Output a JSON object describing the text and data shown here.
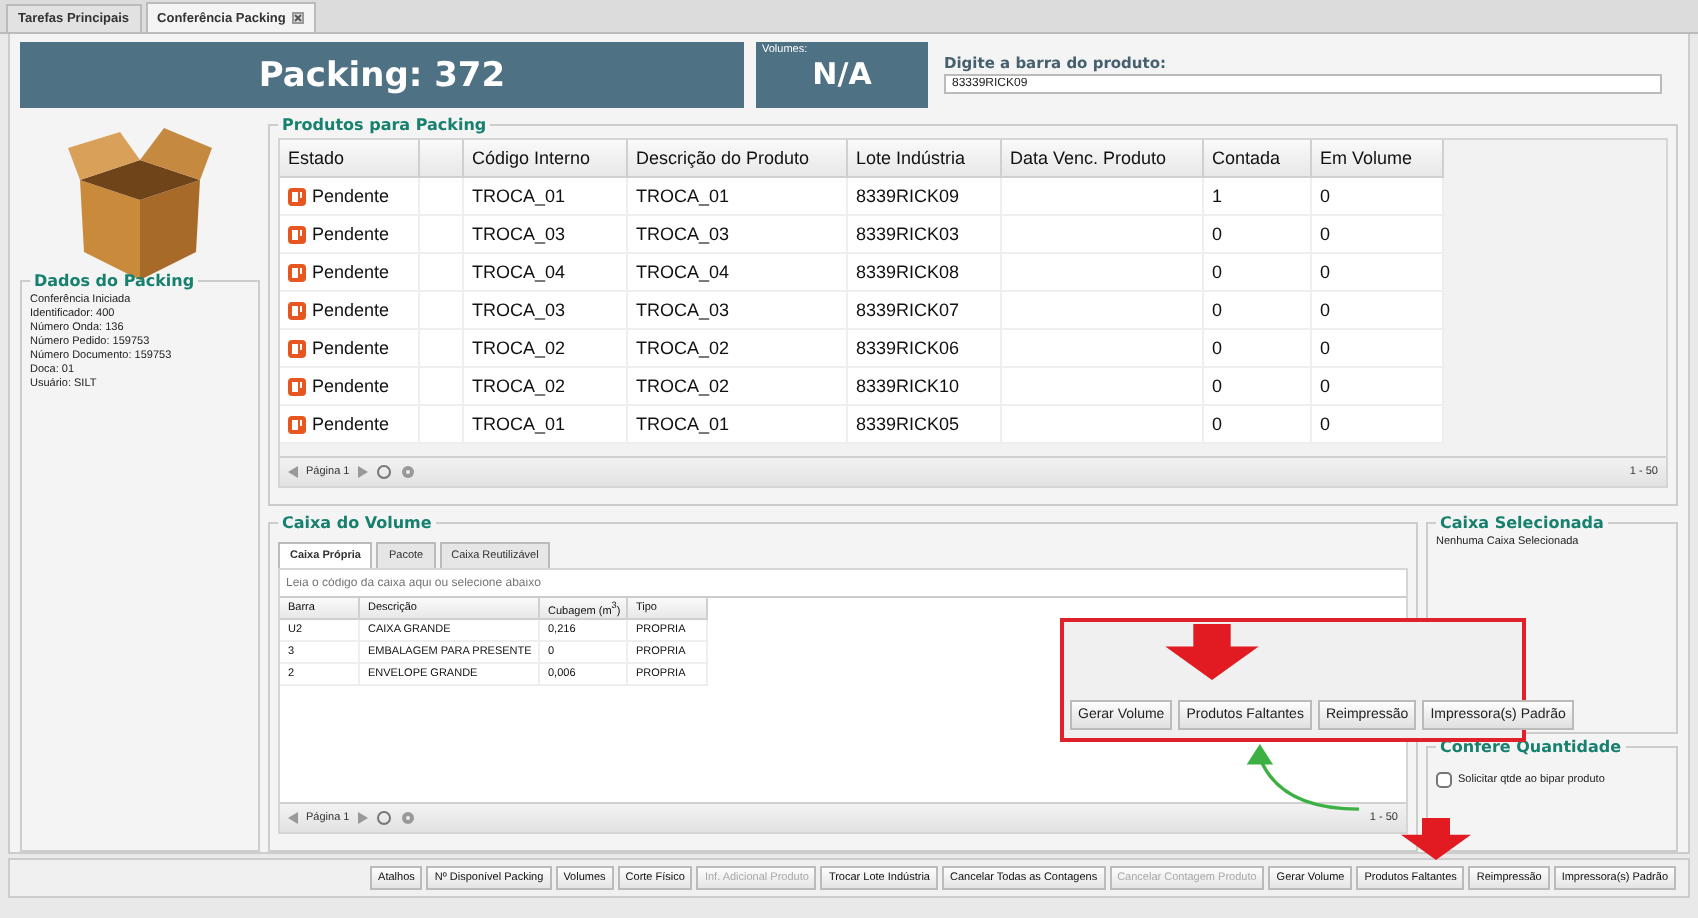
{
  "tabs": [
    {
      "label": "Tarefas Principais",
      "selected": false,
      "closable": false
    },
    {
      "label": "Conferência Packing",
      "selected": true,
      "closable": true
    }
  ],
  "header": {
    "packing": "Packing: 372",
    "volumes_label": "Volumes:",
    "volumes": "N/A",
    "barcode_label": "Digite a barra do produto:",
    "barcode_value": "83339RICK09"
  },
  "dados": {
    "title": "Dados do Packing",
    "lines": [
      "Conferência Iniciada",
      "Identificador: 400",
      "Número Onda: 136",
      "Número Pedido: 159753",
      "Número Documento: 159753",
      "Doca: 01",
      "Usuário: SILT"
    ]
  },
  "produtos": {
    "title": "Produtos para Packing",
    "columns": [
      "Estado",
      "",
      "Código Interno",
      "Descrição do Produto",
      "Lote Indústria",
      "Data Venc. Produto",
      "Contada",
      "Em Volume"
    ],
    "rows": [
      [
        "Pendente",
        "",
        "TROCA_01",
        "TROCA_01",
        "8339RICK09",
        "",
        "1",
        "0"
      ],
      [
        "Pendente",
        "",
        "TROCA_03",
        "TROCA_03",
        "8339RICK03",
        "",
        "0",
        "0"
      ],
      [
        "Pendente",
        "",
        "TROCA_04",
        "TROCA_04",
        "8339RICK08",
        "",
        "0",
        "0"
      ],
      [
        "Pendente",
        "",
        "TROCA_03",
        "TROCA_03",
        "8339RICK07",
        "",
        "0",
        "0"
      ],
      [
        "Pendente",
        "",
        "TROCA_02",
        "TROCA_02",
        "8339RICK06",
        "",
        "0",
        "0"
      ],
      [
        "Pendente",
        "",
        "TROCA_02",
        "TROCA_02",
        "8339RICK10",
        "",
        "0",
        "0"
      ],
      [
        "Pendente",
        "",
        "TROCA_01",
        "TROCA_01",
        "8339RICK05",
        "",
        "0",
        "0"
      ]
    ],
    "pager": "Página 1",
    "range": "1 - 50"
  },
  "caixa": {
    "title": "Caixa do Volume",
    "tabs": [
      {
        "label": "Caixa Própria",
        "selected": true
      },
      {
        "label": "Pacote",
        "selected": false
      },
      {
        "label": "Caixa Reutilizável",
        "selected": false
      }
    ],
    "placeholder": "Leia o código da caixa aqui ou selecione abaixo",
    "columns": [
      "Barra",
      "Descrição",
      "Cubagem (m$^{3}$)",
      "Tipo"
    ],
    "rows": [
      [
        "U2",
        "CAIXA GRANDE",
        "0,216",
        "PROPRIA"
      ],
      [
        "3",
        "EMBALAGEM PARA PRESENTE",
        "0",
        "PROPRIA"
      ],
      [
        "2",
        "ENVELOPE GRANDE",
        "0,006",
        "PROPRIA"
      ]
    ],
    "pager": "Página 1",
    "range": "1 - 50"
  },
  "caixa_selecionada": {
    "title": "Caixa Selecionada",
    "text": "Nenhuma Caixa Selecionada"
  },
  "confere": {
    "title": "Confere Quantidade",
    "label": "Solicitar qtde ao bipar produto",
    "checked": false
  },
  "toolbar": [
    {
      "label": "Atalhos",
      "disabled": false
    },
    {
      "label": "Nº Disponível Packing",
      "disabled": false
    },
    {
      "label": "Volumes",
      "disabled": false
    },
    {
      "label": "Corte Físico",
      "disabled": false
    },
    {
      "label": "Inf. Adicional Produto",
      "disabled": true
    },
    {
      "label": "Trocar Lote Indústria",
      "disabled": false
    },
    {
      "label": "Cancelar Todas as Contagens",
      "disabled": false
    },
    {
      "label": "Cancelar Contagem Produto",
      "disabled": true
    },
    {
      "label": "Gerar Volume",
      "disabled": false
    },
    {
      "label": "Produtos Faltantes",
      "disabled": false
    },
    {
      "label": "Reimpressão",
      "disabled": false
    },
    {
      "label": "Impressora(s) Padrão",
      "disabled": false
    }
  ],
  "callout": {
    "buttons": [
      "Gerar Volume",
      "Produtos Faltantes",
      "Reimpressão",
      "Impressora(s) Padrão"
    ]
  }
}
